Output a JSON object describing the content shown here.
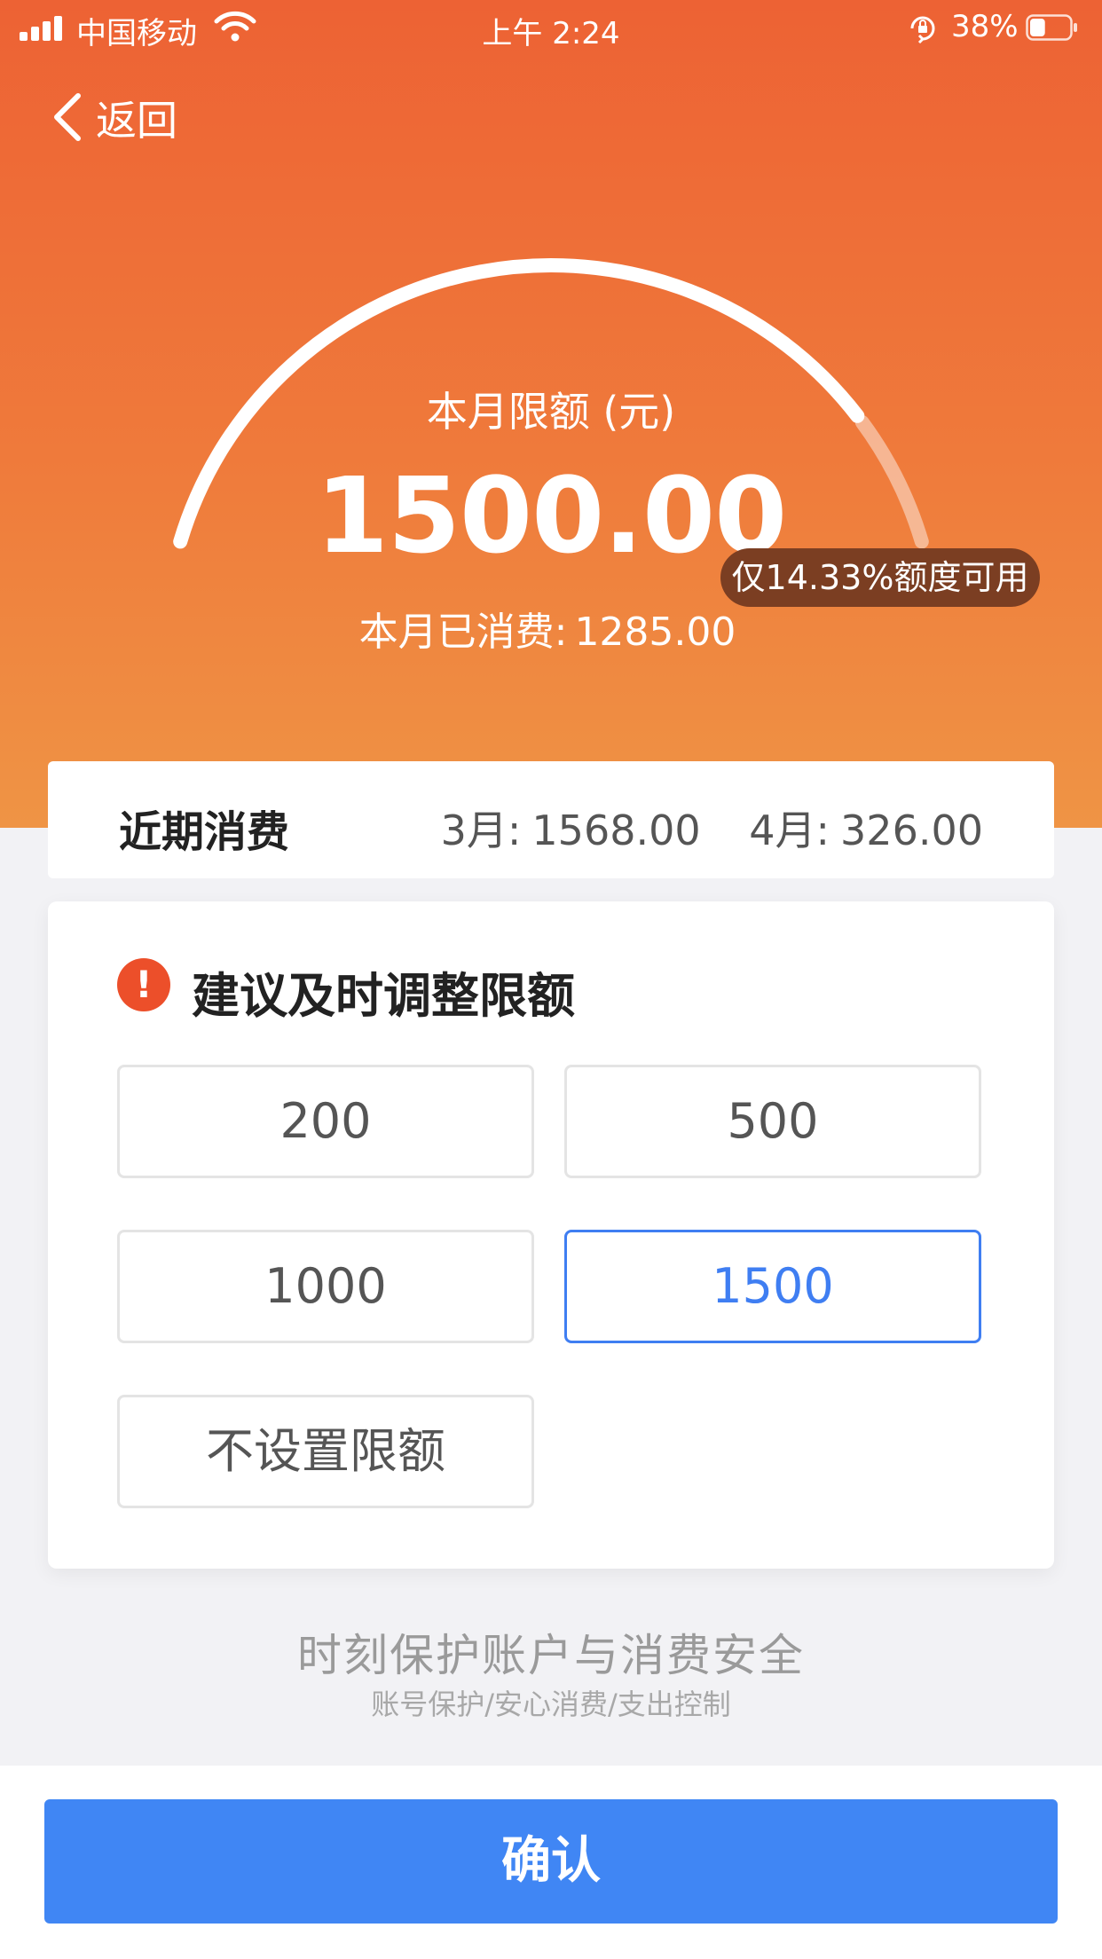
{
  "status_bar": {
    "carrier": "中国移动",
    "time": "上午 2:24",
    "battery_percent": "38%",
    "battery_level": 0.38
  },
  "nav": {
    "back_label": "返回"
  },
  "gauge": {
    "limit_label": "本月限额 (元)",
    "limit_amount": "1500.00",
    "spent_label": "本月已消费:",
    "spent_amount": "1285.00",
    "available_text": "仅14.33%额度可用",
    "available_fraction": 0.1433
  },
  "recent": {
    "title": "近期消费",
    "items": [
      {
        "month": "3月:",
        "amount": "1568.00"
      },
      {
        "month": "4月:",
        "amount": "326.00"
      }
    ]
  },
  "adjust": {
    "title": "建议及时调整限额",
    "warn_glyph": "!",
    "options": [
      {
        "label": "200",
        "selected": false
      },
      {
        "label": "500",
        "selected": false
      },
      {
        "label": "1000",
        "selected": false
      },
      {
        "label": "1500",
        "selected": true
      },
      {
        "label": "不设置限额",
        "selected": false
      }
    ]
  },
  "footer": {
    "slogan": "时刻保护账户与消费安全",
    "sub": "账号保护/安心消费/支出控制",
    "confirm_label": "确认"
  },
  "colors": {
    "header_top": "#ed6234",
    "header_bottom": "#ef9445",
    "accent_blue": "#4086f4",
    "warning_red": "#ec4f2a",
    "pill_brown": "#7b3e22"
  }
}
